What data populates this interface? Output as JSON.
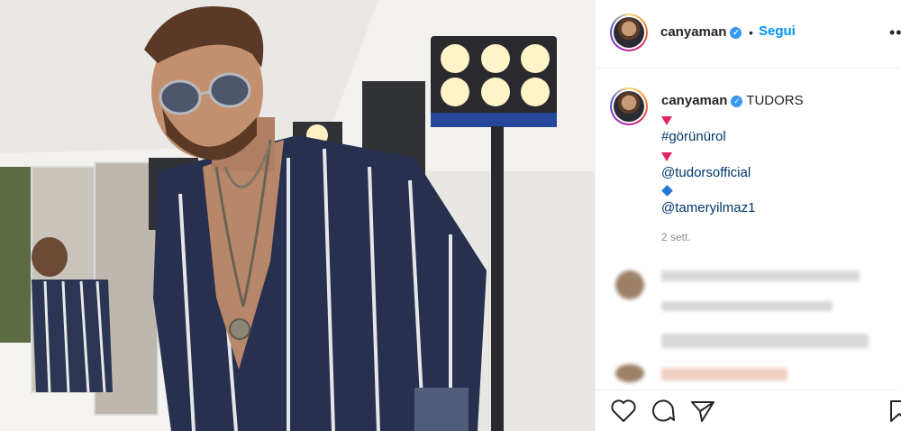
{
  "post": {
    "header": {
      "username": "canyaman",
      "separator": "•",
      "follow_label": "Segui",
      "more_label": "•••"
    },
    "caption": {
      "username": "canyaman",
      "text": "TUDORS",
      "hashtag": "#görünürol",
      "mention1": "@tudorsofficial",
      "mention2": "@tameryilmaz1",
      "time": "2 sett."
    },
    "colors": {
      "accent": "#0095f6",
      "verified": "#3897f0",
      "red_triangle": "#e0245e",
      "blue_diamond": "#1e78d6"
    },
    "icons": [
      "verified-badge-icon",
      "heart-icon",
      "comment-icon",
      "share-icon",
      "bookmark-icon",
      "red-triangle-emoji",
      "blue-diamond-emoji"
    ]
  }
}
